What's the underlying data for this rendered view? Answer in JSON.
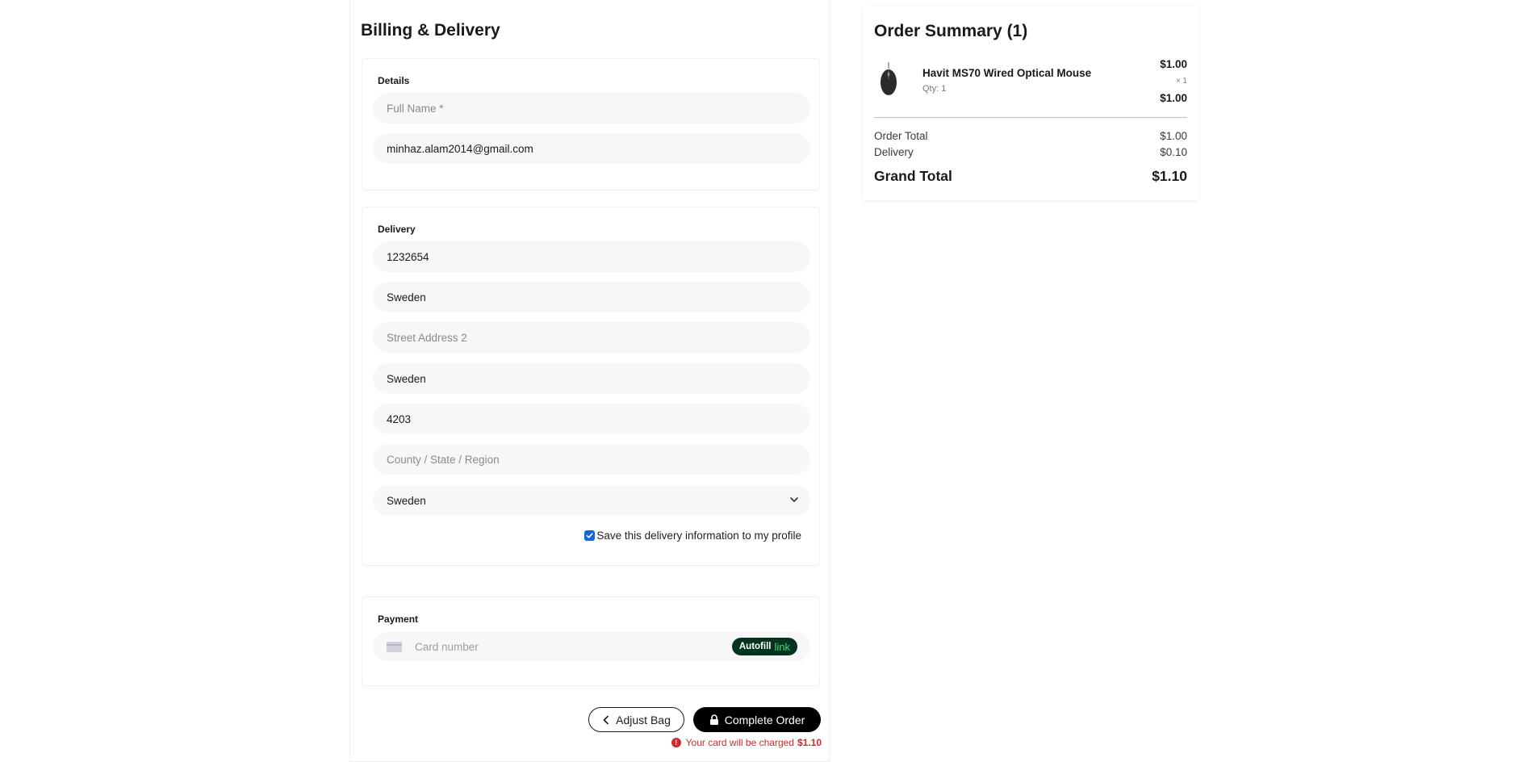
{
  "billing": {
    "title": "Billing & Delivery",
    "details": {
      "label": "Details",
      "full_name_placeholder": "Full Name *",
      "email_value": "minhaz.alam2014@gmail.com"
    },
    "delivery": {
      "label": "Delivery",
      "street1_value": "1232654",
      "field2_value": "Sweden",
      "street2_placeholder": "Street Address 2",
      "city_value": "Sweden",
      "postcode_value": "4203",
      "region_placeholder": "County / State / Region",
      "country_selected": "Sweden",
      "save_label": "Save this delivery information to my profile",
      "save_checked": true
    },
    "payment": {
      "label": "Payment",
      "card_placeholder": "Card number",
      "autofill_label": "Autofill",
      "autofill_link": "link"
    },
    "actions": {
      "adjust_label": "Adjust Bag",
      "complete_label": "Complete Order",
      "charge_note": "Your card will be charged",
      "charge_amount": "$1.10"
    }
  },
  "summary": {
    "title": "Order Summary (1)",
    "item": {
      "name": "Havit MS70 Wired Optical Mouse",
      "qty": "Qty: 1",
      "unit_price": "$1.00",
      "multiplier": "× 1",
      "line_total": "$1.00"
    },
    "order_total_label": "Order Total",
    "order_total_value": "$1.00",
    "delivery_label": "Delivery",
    "delivery_value": "$0.10",
    "grand_total_label": "Grand Total",
    "grand_total_value": "$1.10"
  },
  "colors": {
    "accent": "#000000",
    "checkbox": "#1565d8",
    "error": "#d22b2b",
    "autofill_bg": "#04341f",
    "autofill_link": "#33dd77"
  }
}
